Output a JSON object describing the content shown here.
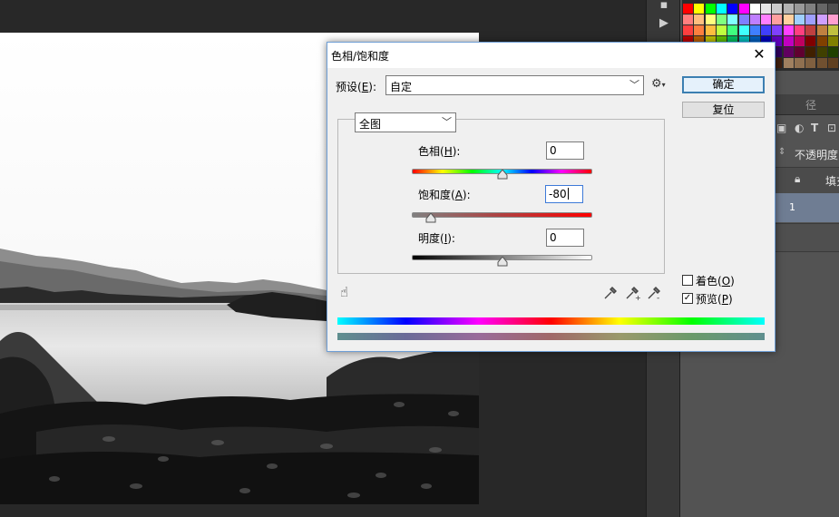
{
  "dialog": {
    "title": "色相/饱和度",
    "preset_label_prefix": "预设(",
    "preset_label_key": "E",
    "preset_label_suffix": "):",
    "preset_value": "自定",
    "ok_label": "确定",
    "reset_label": "复位",
    "channel_value": "全图",
    "hue": {
      "label_prefix": "色相(",
      "key": "H",
      "label_suffix": "):",
      "value": "0"
    },
    "saturation": {
      "label_prefix": "饱和度(",
      "key": "A",
      "label_suffix": "):",
      "value": "-80"
    },
    "lightness": {
      "label_prefix": "明度(",
      "key": "I",
      "label_suffix": "):",
      "value": "0"
    },
    "colorize": {
      "label_prefix": "着色(",
      "key": "O",
      "label_suffix": ")",
      "checked": false
    },
    "preview": {
      "label_prefix": "预览(",
      "key": "P",
      "label_suffix": ")",
      "checked": true
    }
  },
  "layers_panel": {
    "tab_label": "径",
    "opacity_label": "不透明度",
    "fill_label": "填充",
    "layer_number": "1"
  },
  "icons": {
    "close": "close-icon",
    "gear": "gear-icon",
    "hand": "targeted-adjustment-icon",
    "eyedropper": "eyedropper-icon",
    "eyedropper_plus": "eyedropper-add-icon",
    "eyedropper_minus": "eyedropper-subtract-icon"
  }
}
